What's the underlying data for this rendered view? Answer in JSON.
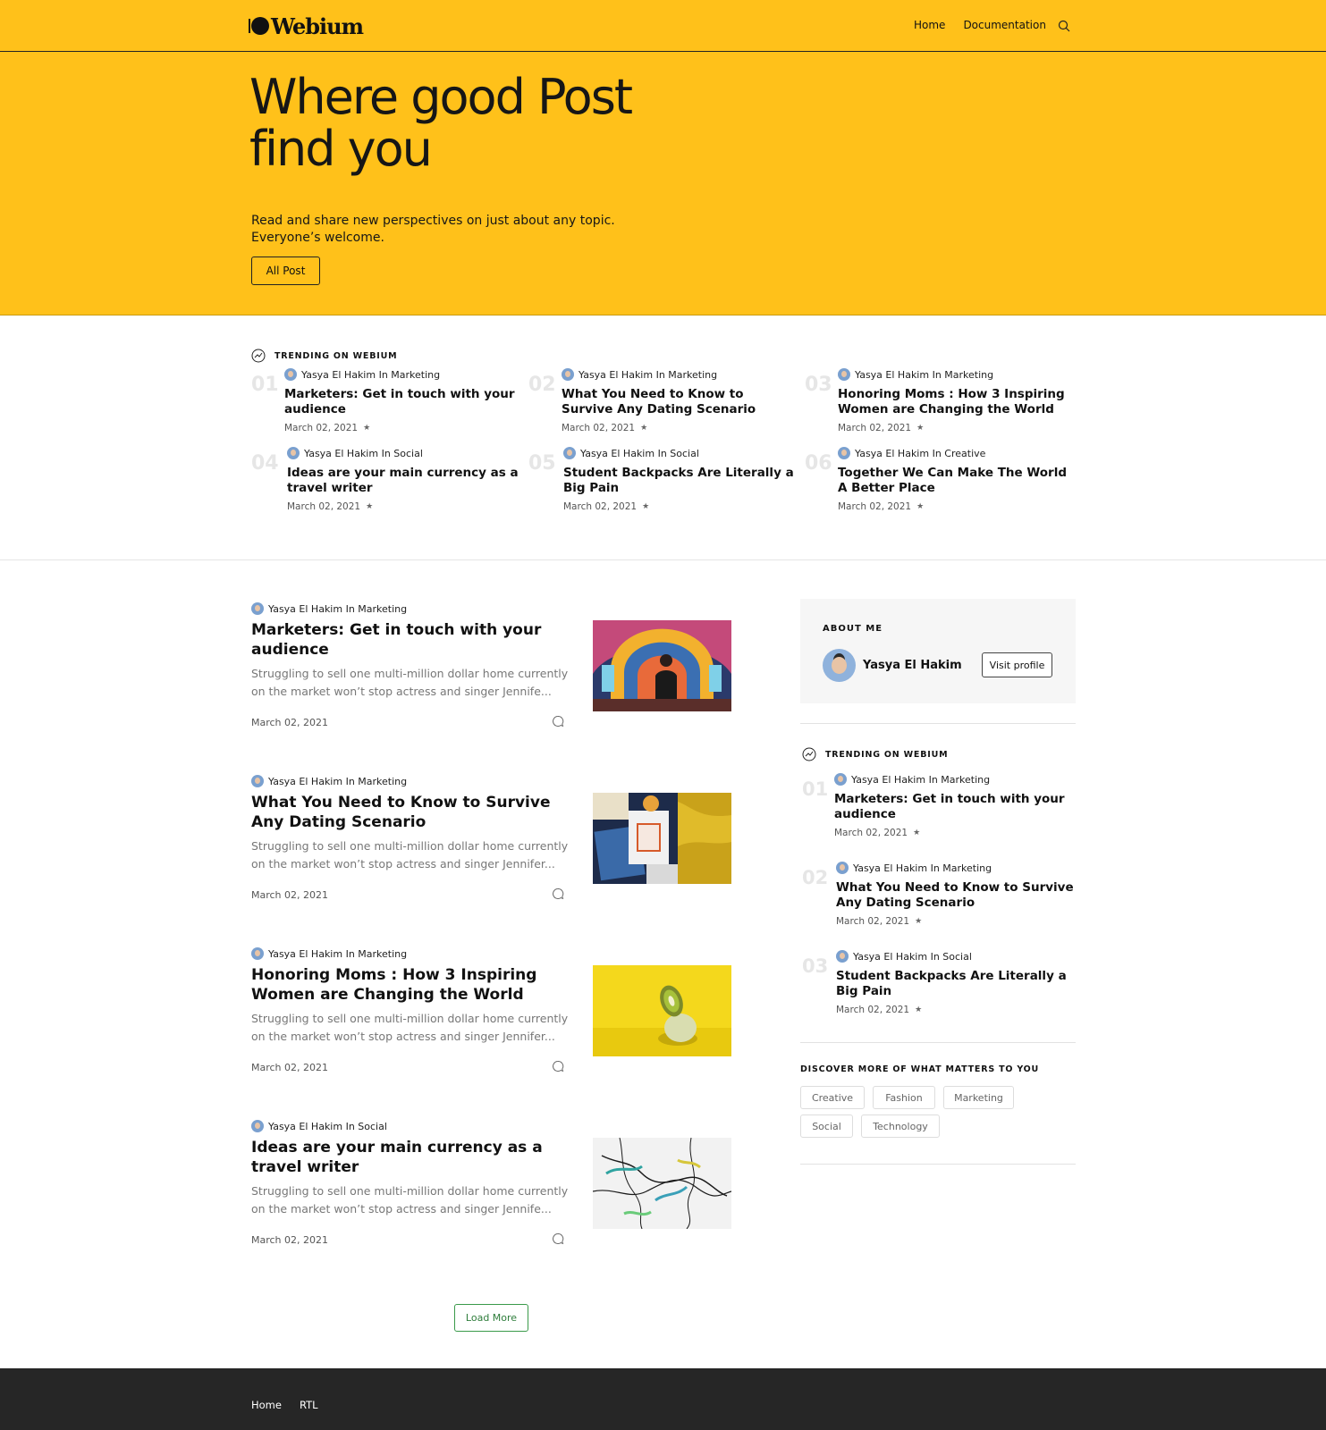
{
  "brand": {
    "name": "Webium"
  },
  "nav": {
    "home": "Home",
    "documentation": "Documentation"
  },
  "hero": {
    "title_line1": "Where good Post",
    "title_line2": "find you",
    "subtitle_line1": "Read and share new perspectives on just about any topic.",
    "subtitle_line2": "Everyone’s welcome.",
    "button": "All Post"
  },
  "trending": {
    "heading": "TRENDING ON WEBIUM",
    "items": [
      {
        "num": "01",
        "meta": "Yasya El Hakim In Marketing",
        "title": "Marketers: Get in touch with your audience",
        "date": "March 02, 2021"
      },
      {
        "num": "02",
        "meta": "Yasya El Hakim In Marketing",
        "title": "What You Need to Know to Survive Any Dating Scenario",
        "date": "March 02, 2021"
      },
      {
        "num": "03",
        "meta": "Yasya El Hakim In Marketing",
        "title": "Honoring Moms : How 3 Inspiring Women are Changing the World",
        "date": "March 02, 2021"
      },
      {
        "num": "04",
        "meta": "Yasya El Hakim In Social",
        "title": "Ideas are your main currency as a travel writer",
        "date": "March 02, 2021"
      },
      {
        "num": "05",
        "meta": "Yasya El Hakim In Social",
        "title": "Student Backpacks Are Literally a Big Pain",
        "date": "March 02, 2021"
      },
      {
        "num": "06",
        "meta": "Yasya El Hakim In Creative",
        "title": "Together We Can Make The World A Better Place",
        "date": "March 02, 2021"
      }
    ]
  },
  "posts": [
    {
      "meta": "Yasya El Hakim In Marketing",
      "title": "Marketers: Get in touch with your audience",
      "excerpt": "Struggling to sell one multi-million dollar home currently on the market won’t stop actress and singer Jennife...",
      "date": "March 02, 2021"
    },
    {
      "meta": "Yasya El Hakim In Marketing",
      "title": "What You Need to Know to Survive Any Dating Scenario",
      "excerpt": "Struggling to sell one multi-million dollar home currently on the market won’t stop actress and singer Jennifer...",
      "date": "March 02, 2021"
    },
    {
      "meta": "Yasya El Hakim In Marketing",
      "title": "Honoring Moms : How 3 Inspiring Women are Changing the World",
      "excerpt": "Struggling to sell one multi-million dollar home currently on the market won’t stop actress and singer Jennifer...",
      "date": "March 02, 2021"
    },
    {
      "meta": "Yasya El Hakim In Social",
      "title": "Ideas are your main currency as a travel writer",
      "excerpt": "Struggling to sell one multi-million dollar home currently on the market won’t stop actress and singer Jennife...",
      "date": "March 02, 2021"
    }
  ],
  "load_more": "Load More",
  "about": {
    "heading": "ABOUT ME",
    "name": "Yasya El Hakim",
    "button": "Visit profile"
  },
  "side_trending": {
    "heading": "TRENDING ON WEBIUM",
    "items": [
      {
        "num": "01",
        "meta": "Yasya El Hakim In Marketing",
        "title": "Marketers: Get in touch with your audience",
        "date": "March 02, 2021"
      },
      {
        "num": "02",
        "meta": "Yasya El Hakim In Marketing",
        "title": "What You Need to Know to Survive Any Dating Scenario",
        "date": "March 02, 2021"
      },
      {
        "num": "03",
        "meta": "Yasya El Hakim In Social",
        "title": "Student Backpacks Are Literally a Big Pain",
        "date": "March 02, 2021"
      }
    ]
  },
  "discover": {
    "heading": "DISCOVER MORE OF WHAT MATTERS TO YOU",
    "tags": [
      "Creative",
      "Fashion",
      "Marketing",
      "Social",
      "Technology"
    ]
  },
  "footer": {
    "home": "Home",
    "rtl": "RTL"
  },
  "colors": {
    "accent": "#ffc11a",
    "footer": "#262626",
    "load_more": "#2e7d3b"
  },
  "icons": {
    "search": "search-icon",
    "trend": "trending-icon",
    "comment": "comment-icon",
    "star": "star-icon"
  }
}
